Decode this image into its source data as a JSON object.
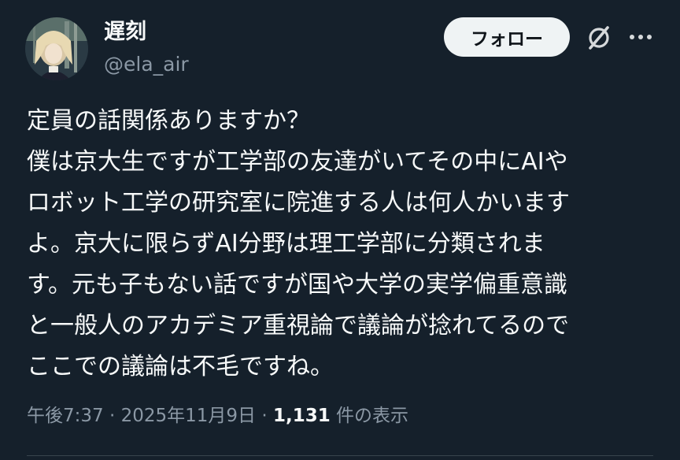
{
  "author": {
    "display_name": "遅刻",
    "handle": "@ela_air",
    "avatar_icon": "user-avatar-image"
  },
  "actions": {
    "follow_label": "フォロー",
    "grok_icon": "grok-slash-icon",
    "more_icon": "more-dots-icon"
  },
  "post": {
    "text": "定員の話関係ありますか？\n僕は京大生ですが工学部の友達がいてその中にAIや\nロボット工学の研究室に院進する人は何人かいます\nよ。京大に限らずAI分野は理工学部に分類されま\nす。元も子もない話ですが国や大学の実学偏重意識\nと一般人のアカデミア重視論で議論が捻れてるので\nここでの議論は不毛ですね。"
  },
  "meta": {
    "time": "午後7:37",
    "separator1": " · ",
    "date": "2025年11月9日",
    "separator2": " · ",
    "view_count": "1,131",
    "view_label": " 件の表示"
  },
  "colors": {
    "background": "#15202b",
    "text_primary": "#f7f9f9",
    "text_secondary": "#8b98a5",
    "button_bg": "#eff3f4"
  }
}
